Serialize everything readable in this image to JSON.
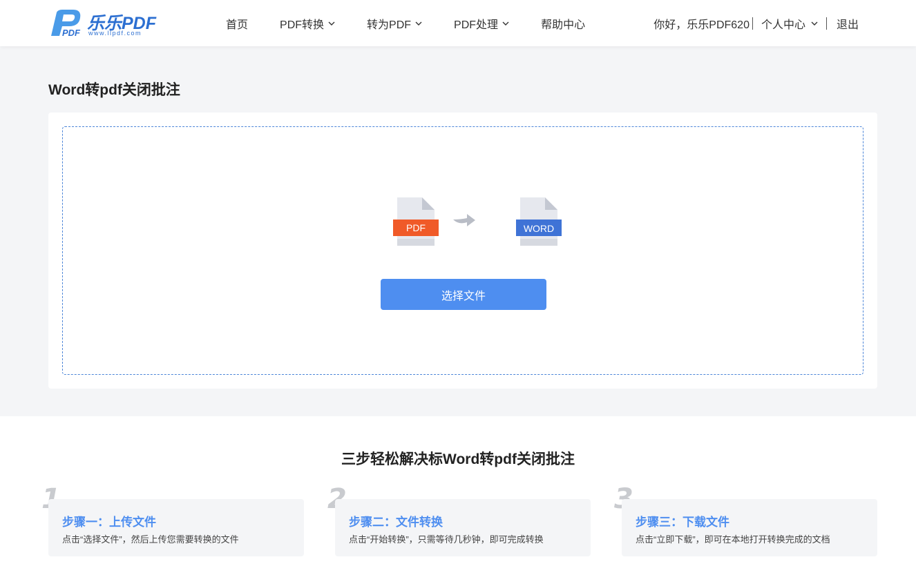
{
  "header": {
    "logo_name": "乐乐PDF",
    "logo_url": "www.llpdf.com",
    "nav": [
      {
        "label": "首页",
        "has_dropdown": false
      },
      {
        "label": "PDF转换",
        "has_dropdown": true
      },
      {
        "label": "转为PDF",
        "has_dropdown": true
      },
      {
        "label": "PDF处理",
        "has_dropdown": true
      },
      {
        "label": "帮助中心",
        "has_dropdown": false
      }
    ],
    "greeting": "你好，乐乐PDF620",
    "user_menu": "个人中心",
    "logout": "退出"
  },
  "main": {
    "page_title": "Word转pdf关闭批注",
    "from_format": "PDF",
    "to_format": "WORD",
    "select_button": "选择文件"
  },
  "steps": {
    "title": "三步轻松解决标Word转pdf关闭批注",
    "items": [
      {
        "num": "1",
        "title": "步骤一：上传文件",
        "desc": "点击“选择文件”，然后上传您需要转换的文件"
      },
      {
        "num": "2",
        "title": "步骤二：文件转换",
        "desc": "点击“开始转换”，只需等待几秒钟，即可完成转换"
      },
      {
        "num": "3",
        "title": "步骤三：下载文件",
        "desc": "点击“立即下载”，即可在本地打开转换完成的文档"
      }
    ]
  },
  "colors": {
    "brand_blue": "#2c6fd1",
    "button_blue": "#4e8ef0",
    "pdf_orange": "#f05a28",
    "word_blue": "#3f73d6",
    "page_bg": "#f4f5f7"
  }
}
